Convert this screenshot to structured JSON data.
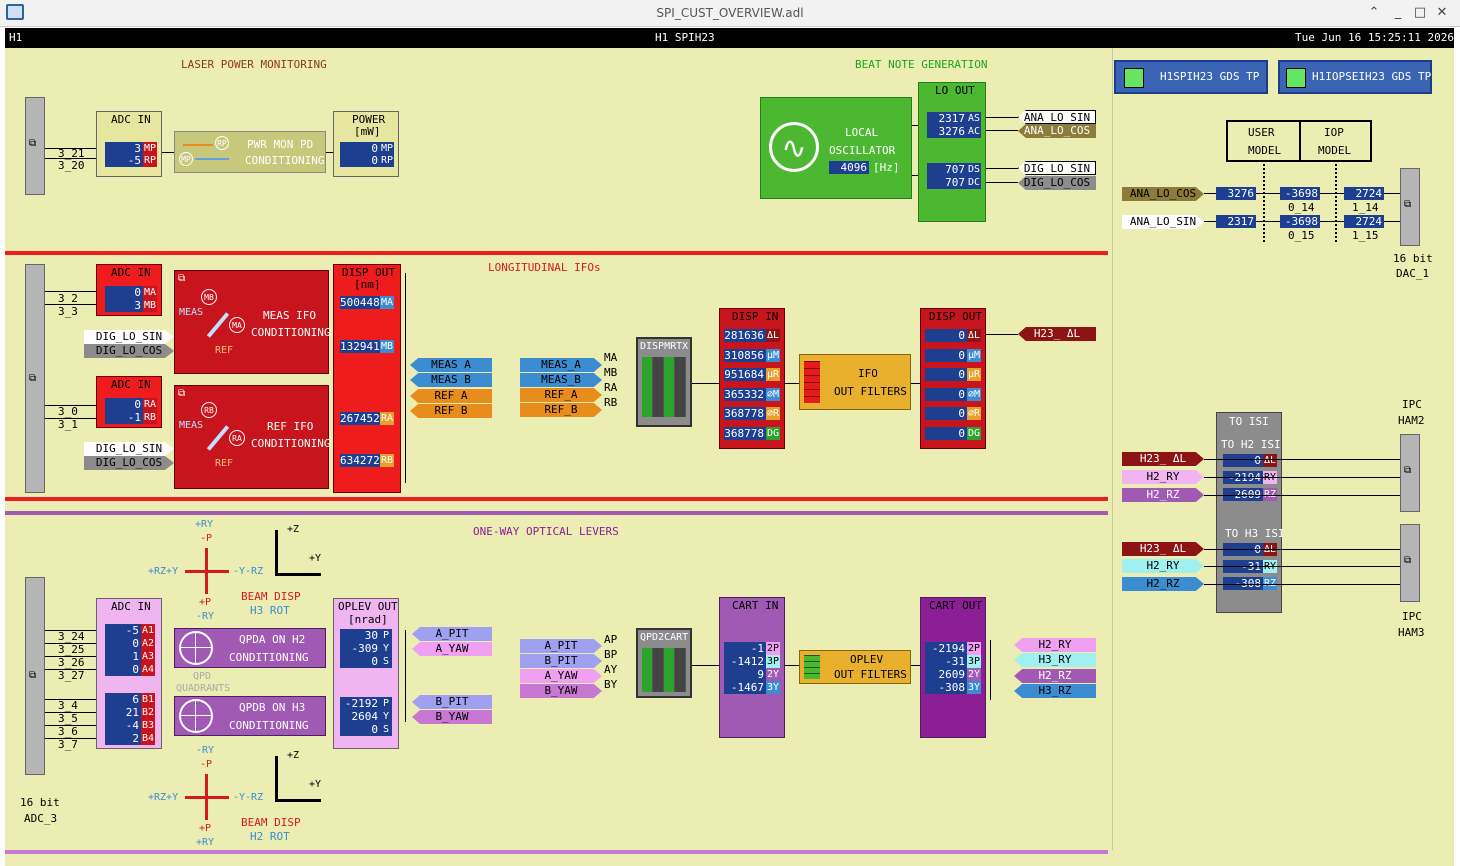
{
  "window": {
    "title": "SPI_CUST_OVERVIEW.adl"
  },
  "header": {
    "site": "H1",
    "system": "H1 SPIH23",
    "datetime": "Tue Jun 16 15:25:11 2026"
  },
  "sections": {
    "laser": "LASER POWER MONITORING",
    "beat": "BEAT NOTE GENERATION",
    "long": "LONGITUDINAL IFOs",
    "optical": "ONE-WAY OPTICAL LEVERS"
  },
  "gds": {
    "spi": "H1SPIH23 GDS TP",
    "iop": "H1IOPSEIH23 GDS TP"
  },
  "laser": {
    "chan1": "3_21",
    "chan2": "3_20",
    "adc_title": "ADC IN",
    "adc_vals": [
      "3",
      "-5"
    ],
    "adc_tags": [
      "MP",
      "RP"
    ],
    "pd_label1": "PWR MON PD",
    "pd_label2": "CONDITIONING",
    "rp": "RP",
    "mp": "MP",
    "power_title": "POWER",
    "power_unit": "[mW]",
    "power_vals": [
      "0",
      "0"
    ],
    "power_tags": [
      "MP",
      "RP"
    ]
  },
  "lo": {
    "osc1": "LOCAL",
    "osc2": "OSCILLATOR",
    "freq": "4096",
    "freq_unit": "[Hz]",
    "out_title": "LO OUT",
    "vals": [
      "2317",
      "3276",
      "707",
      "707"
    ],
    "tags": [
      "AS",
      "AC",
      "DS",
      "DC"
    ],
    "outs": [
      "ANA_LO_SIN",
      "ANA_LO_COS",
      "DIG_LO_SIN",
      "DIG_LO_COS"
    ]
  },
  "model": {
    "user1": "USER",
    "user2": "MODEL",
    "iop1": "IOP",
    "iop2": "MODEL",
    "in_cos": "ANA_LO_COS",
    "in_sin": "ANA_LO_SIN",
    "r1": [
      "3276",
      "-3698",
      "2724"
    ],
    "r2": [
      "2317",
      "-3698",
      "2724"
    ],
    "c1": "0_14",
    "c2": "0_15",
    "c3": "1_14",
    "c4": "1_15",
    "dac1": "16 bit",
    "dac2": "DAC_1"
  },
  "long": {
    "chan": [
      "3_2",
      "3_3",
      "3_0",
      "3_1"
    ],
    "adc_title": "ADC IN",
    "adc1_vals": [
      "0",
      "3"
    ],
    "adc1_tags": [
      "MA",
      "MB"
    ],
    "adc2_vals": [
      "0",
      "-1"
    ],
    "adc2_tags": [
      "RA",
      "RB"
    ],
    "dig_sin": "DIG_LO_SIN",
    "dig_cos": "DIG_LO_COS",
    "meas_l1": "MEAS IFO",
    "meas_l2": "CONDITIONING",
    "ref_l1": "REF IFO",
    "ref_l2": "CONDITIONING",
    "meas": "MEAS",
    "ref": "REF",
    "mb": "MB",
    "ma": "MA",
    "rb": "RB",
    "ra": "RA",
    "disp_title": "DISP OUT",
    "disp_unit": "[nm]",
    "disp_vals": [
      "500448",
      "132941",
      "267452",
      "634272"
    ],
    "disp_tags": [
      "MA",
      "MB",
      "RA",
      "RB"
    ],
    "outs": [
      "MEAS A",
      "MEAS B",
      "REF A",
      "REF B"
    ],
    "ins": [
      "MEAS_A",
      "MEAS_B",
      "REF_A",
      "REF_B"
    ],
    "in_tags": [
      "MA",
      "MB",
      "RA",
      "RB"
    ],
    "mtrx": "DISPMRTX",
    "dispin_title": "DISP IN",
    "dispin_vals": [
      "281636",
      "310856",
      "951684",
      "365332",
      "368778",
      "368778"
    ],
    "dispin_tags": [
      "ΔL",
      "μM",
      "μR",
      "∅M",
      "∅R",
      "DG"
    ],
    "filt1": "IFO",
    "filt2": "OUT FILTERS",
    "dispout_title": "DISP OUT",
    "dispout_vals": [
      "0",
      "0",
      "0",
      "0",
      "0",
      "0"
    ],
    "dispout_tags": [
      "ΔL",
      "μM",
      "μR",
      "∅M",
      "∅R",
      "DG"
    ],
    "h23": "H23_ ΔL"
  },
  "isi": {
    "title": "TO ISI",
    "h2": "TO H2 ISI",
    "h3": "TO H3 ISI",
    "h2_ins": [
      "H23_ ΔL",
      "H2_RY",
      "H2_RZ"
    ],
    "h2_vals": [
      "0",
      "-2194",
      "2609"
    ],
    "h2_tags": [
      "ΔL",
      "RY",
      "RZ"
    ],
    "h3_ins": [
      "H23_ ΔL",
      "H2_RY",
      "H2_RZ"
    ],
    "h3_vals": [
      "0",
      "-31",
      "-308"
    ],
    "h3_tags": [
      "ΔL",
      "RY",
      "RZ"
    ],
    "ipc": "IPC",
    "ham2": "HAM2",
    "ham3": "HAM3"
  },
  "opt": {
    "chan": [
      "3_24",
      "3_25",
      "3_26",
      "3_27",
      "3_4",
      "3_5",
      "3_6",
      "3_7"
    ],
    "adc_title": "ADC IN",
    "a_vals": [
      "-5",
      "0",
      "1",
      "0"
    ],
    "a_tags": [
      "A1",
      "A2",
      "A3",
      "A4"
    ],
    "b_vals": [
      "6",
      "21",
      "-4",
      "2"
    ],
    "b_tags": [
      "B1",
      "B2",
      "B3",
      "B4"
    ],
    "adc3_1": "16 bit",
    "adc3_2": "ADC_3",
    "qpda1": "QPDA ON H2",
    "qpda2": "CONDITIONING",
    "qpdb1": "QPDB ON H3",
    "qpdb2": "CONDITIONING",
    "qpd_q1": "QPD",
    "qpd_q2": "QUADRANTS",
    "top_ry": "+RY",
    "top_p": "-P",
    "top_left": "+RZ+Y",
    "top_right": "-Y-RZ",
    "top_pp": "+P",
    "top_mry": "-RY",
    "beam1": "BEAM DISP",
    "beam_h3": "H3 ROT",
    "beam_h2": "H2 ROT",
    "bot_ry": "-RY",
    "bot_p": "-P",
    "bot_left": "+RZ+Y",
    "bot_right": "-Y-RZ",
    "bot_pp": "+P",
    "bot_pry": "+RY",
    "z": "+Z",
    "y": "+Y",
    "oplev_title": "OPLEV OUT",
    "oplev_unit": "[nrad]",
    "oa_vals": [
      "30",
      "-309",
      "0"
    ],
    "ob_vals": [
      "-2192",
      "2604",
      "0"
    ],
    "o_tags": [
      "P",
      "Y",
      "S"
    ],
    "outs": [
      "A_PIT",
      "A_YAW",
      "B_PIT",
      "B_YAW"
    ],
    "ins": [
      "A_PIT",
      "B_PIT",
      "A_YAW",
      "B_YAW"
    ],
    "in_tags": [
      "AP",
      "BP",
      "AY",
      "BY"
    ],
    "qpd2cart": "QPD2CART",
    "cartin_title": "CART IN",
    "cartin_vals": [
      "-1",
      "-1412",
      "9",
      "-1467"
    ],
    "cartin_tags": [
      "2P",
      "3P",
      "2Y",
      "3Y"
    ],
    "filt1": "OPLEV",
    "filt2": "OUT FILTERS",
    "cartout_title": "CART OUT",
    "cartout_vals": [
      "-2194",
      "-31",
      "2609",
      "-308"
    ],
    "cartout_tags": [
      "2P",
      "3P",
      "2Y",
      "3Y"
    ],
    "cart_outs": [
      "H2_RY",
      "H3_RY",
      "H2_RZ",
      "H3_RZ"
    ]
  },
  "colors": {
    "bg": "#ebedb3",
    "red": "#ee1c1c",
    "darkred": "#c8141c",
    "navy": "#1e3f8f",
    "green": "#4cb832",
    "orange": "#e8b02c",
    "purple": "#8c1e96",
    "pink": "#f0b4f0"
  }
}
